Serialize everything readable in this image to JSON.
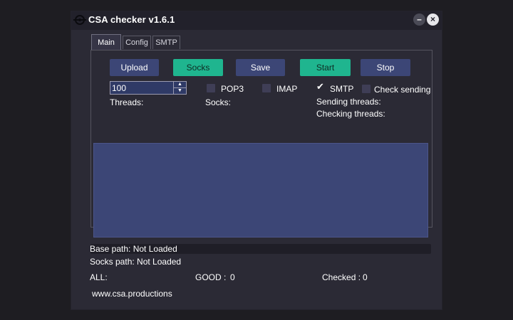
{
  "window": {
    "title": "CSA checker v1.6.1"
  },
  "titlebar": {
    "minimize_label": "–",
    "close_label": "×"
  },
  "tabs": [
    {
      "label": "Main",
      "active": true
    },
    {
      "label": "Config",
      "active": false
    },
    {
      "label": "SMTP",
      "active": false
    }
  ],
  "buttons": {
    "upload": "Upload",
    "socks": "Socks",
    "save": "Save",
    "start": "Start",
    "stop": "Stop"
  },
  "threads": {
    "value": "100",
    "label": "Threads:"
  },
  "checkboxes": {
    "pop3": {
      "label": "POP3",
      "checked": false
    },
    "imap": {
      "label": "IMAP",
      "checked": false
    },
    "smtp": {
      "label": "SMTP",
      "checked": true
    },
    "check_sending": {
      "label": "Check sending",
      "checked": false
    }
  },
  "labels": {
    "socks": "Socks:",
    "sending_threads": "Sending threads:",
    "checking_threads": "Checking threads:"
  },
  "progress": {
    "value": 0
  },
  "status": {
    "base_path": "Base path: Not Loaded",
    "socks_path": "Socks path: Not Loaded",
    "all_label": "ALL:",
    "good_label": "GOOD :",
    "good_value": "0",
    "checked_label": "Checked :",
    "checked_value": "0"
  },
  "footer": {
    "link": "www.csa.productions"
  },
  "colors": {
    "accent_green": "#1fb58f",
    "accent_blue": "#3c4676",
    "window_bg": "#2b2a35"
  }
}
